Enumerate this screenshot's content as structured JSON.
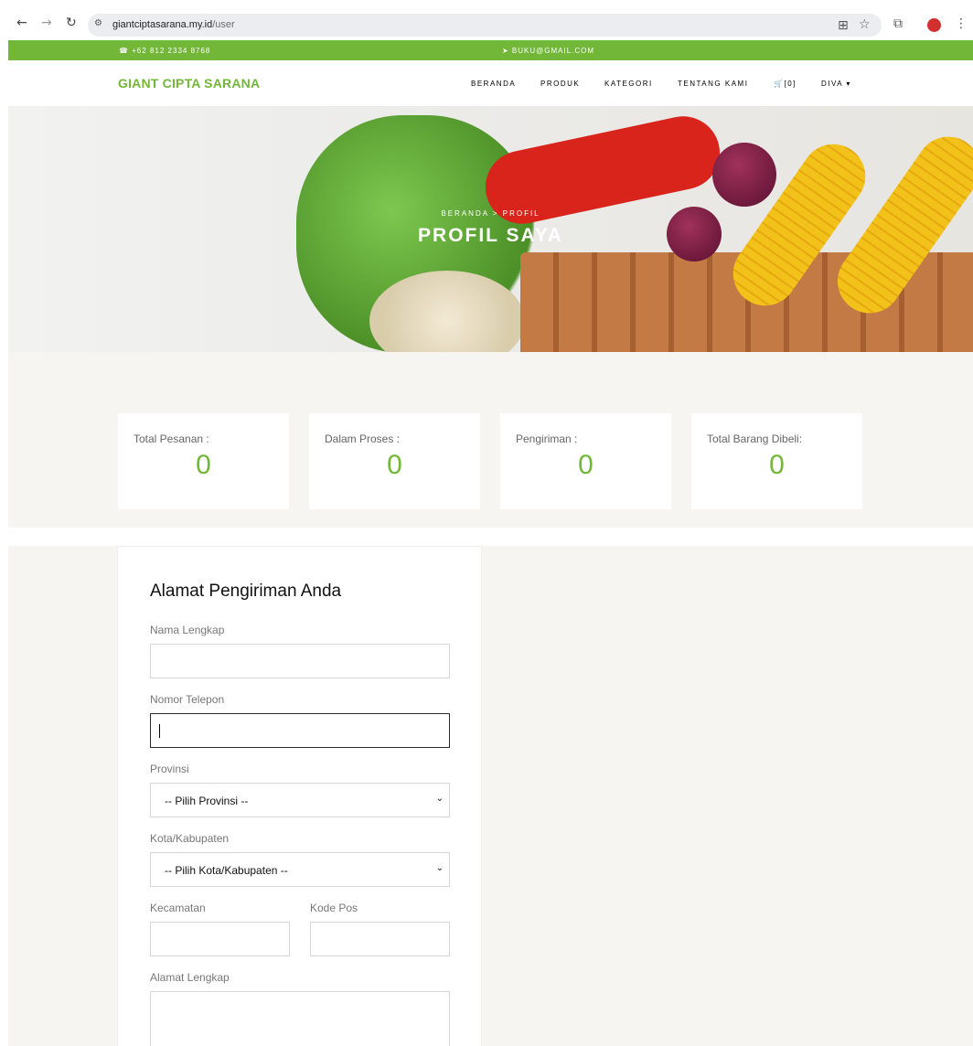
{
  "browser": {
    "url_host": "giantciptasarana.my.id",
    "url_path": "/user",
    "back_icon": "arrow-left-icon",
    "forward_icon": "arrow-right-icon",
    "reload_icon": "reload-icon"
  },
  "topbar": {
    "phone": "☎ +62 812 2334 8768",
    "email": "➤ BUKU@GMAIL.COM"
  },
  "navbar": {
    "brand": "GIANT CIPTA SARANA",
    "items": [
      "BERANDA",
      "PRODUK",
      "KATEGORI",
      "TENTANG KAMI",
      "[0]",
      "DIVA ▾"
    ]
  },
  "hero": {
    "breadcrumb": "BERANDA > PROFIL",
    "title": "PROFIL SAYA"
  },
  "stats": [
    {
      "label": "Total Pesanan :",
      "value": "0"
    },
    {
      "label": "Dalam Proses :",
      "value": "0"
    },
    {
      "label": "Pengiriman :",
      "value": "0"
    },
    {
      "label": "Total Barang Dibeli:",
      "value": "0"
    }
  ],
  "form": {
    "title": "Alamat Pengiriman Anda",
    "nama_label": "Nama Lengkap",
    "telepon_label": "Nomor Telepon",
    "provinsi_label": "Provinsi",
    "provinsi_value": "-- Pilih Provinsi --",
    "kota_label": "Kota/Kabupaten",
    "kota_value": "-- Pilih Kota/Kabupaten --",
    "kecamatan_label": "Kecamatan",
    "kodepos_label": "Kode Pos",
    "alamat_label": "Alamat Lengkap"
  },
  "colors": {
    "accent": "#72b738",
    "background": "#f6f5f1"
  }
}
